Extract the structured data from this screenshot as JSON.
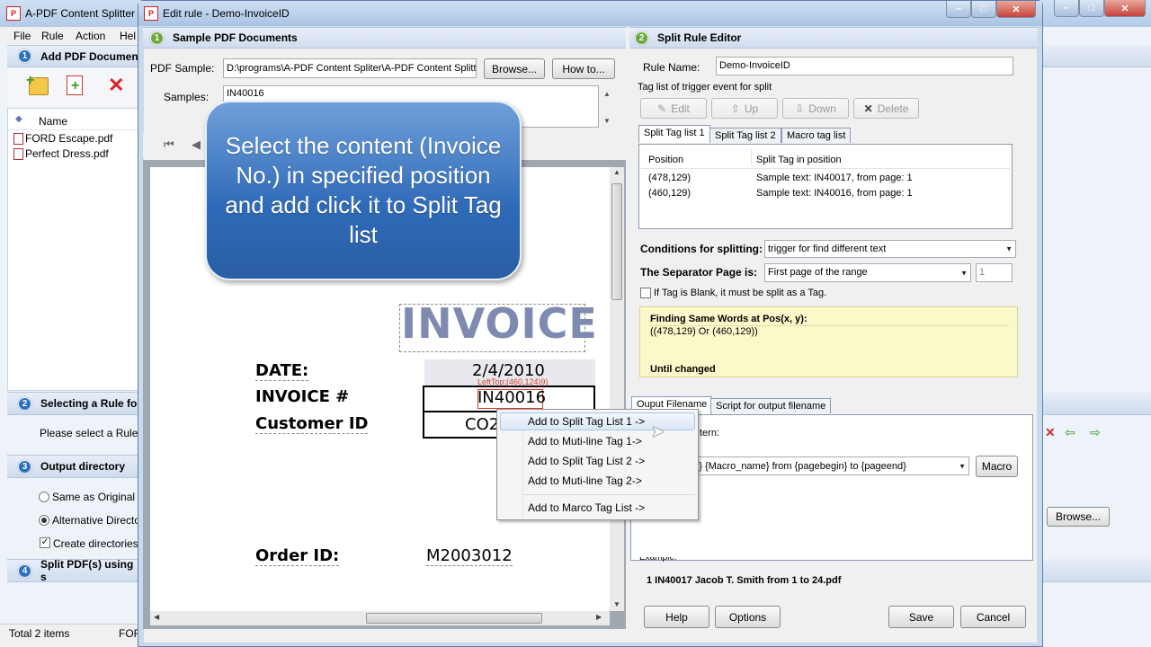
{
  "main_window": {
    "title": "A-PDF Content Splitter",
    "menu": [
      "File",
      "Rule",
      "Action",
      "Hel"
    ],
    "section1": {
      "num": "1",
      "title": "Add PDF Document"
    },
    "files_header": "Name",
    "files": [
      "FORD Escape.pdf",
      "Perfect Dress.pdf"
    ],
    "section2": {
      "num": "2",
      "title": "Selecting a Rule for"
    },
    "select_rule_label": "Please select a Rule:",
    "section3": {
      "num": "3",
      "title": "Output directory"
    },
    "radio_same": "Same as Original di",
    "radio_alt": "Alternative Director",
    "checkbox_create": "Create directories f",
    "browse": "Browse...",
    "section4": {
      "num": "4",
      "title": "Split PDF(s) using s"
    },
    "status_total": "Total 2 items",
    "status_fo": "FOR"
  },
  "dialog": {
    "title": "Edit rule - Demo-InvoiceID",
    "left_panel": {
      "num": "1",
      "title": "Sample PDF Documents",
      "pdf_sample_label": "PDF Sample:",
      "pdf_sample_value": "D:\\programs\\A-PDF Content Spliter\\A-PDF Content Splitte",
      "browse_label": "Browse...",
      "howto_label": "How to...",
      "samples_label": "Samples:",
      "samples_value": "IN40016"
    },
    "callout": "Select the content (Invoice No.) in specified position and add click it to Split Tag list",
    "document": {
      "invoice_title": "INVOICE",
      "date_label": "DATE:",
      "date_value": "2/4/2010",
      "invoice_no_label": "INVOICE #",
      "invoice_no_value": "IN40016",
      "lefttop_tip": "LeftTop:(460,124)9)",
      "customer_label": "Customer ID",
      "customer_value": "CO2",
      "order_label": "Order ID:",
      "order_value": "M2003012"
    },
    "context_menu": [
      "Add to Split Tag List 1 ->",
      "Add to Muti-line Tag  1->",
      "Add to Split Tag List 2 ->",
      "Add to Muti-line Tag  2->",
      "Add to Marco Tag List ->"
    ],
    "right_panel": {
      "num": "2",
      "title": "Split Rule Editor",
      "rule_name_label": "Rule Name:",
      "rule_name_value": "Demo-InvoiceID",
      "tag_list_label": "Tag list of trigger event for split",
      "toolbar": {
        "edit": "Edit",
        "up": "Up",
        "down": "Down",
        "delete": "Delete"
      },
      "tabs": [
        "Split Tag list 1",
        "Split Tag list 2",
        "Macro tag list"
      ],
      "table_headers": [
        "Position",
        "Split Tag in position"
      ],
      "table_rows": [
        [
          "(478,129)",
          "Sample text: IN40017, from page: 1"
        ],
        [
          "(460,129)",
          "Sample text: IN40016, from page: 1"
        ]
      ],
      "conditions_label": "Conditions for splitting:",
      "conditions_value": "trigger for find different text",
      "separator_label": "The Separator Page is:",
      "separator_value": "First page of the range",
      "separator_num": "1",
      "blank_checkbox": "If Tag is Blank, it must be split as a Tag.",
      "info_title": "Finding Same Words at Pos(x, y):",
      "info_value": "((478,129) Or (460,129))",
      "info_until": "Until changed",
      "out_tabs": [
        "Ouput Filename",
        "Script for output filename"
      ],
      "pattern_label": "tern:",
      "pattern_value": "ag} {Macro_name}  from {pagebegin} to {pageend}",
      "macro_btn": "Macro",
      "example_label": "Example:",
      "example_value": "1 IN40017 Jacob T. Smith  from 1 to 24.pdf",
      "help_btn": "Help",
      "options_btn": "Options",
      "save_btn": "Save",
      "cancel_btn": "Cancel"
    }
  },
  "colors": {
    "titlebar": "#bcd3ee",
    "section_header": "#d5e1f0",
    "callout": "#2f6ab8",
    "info_box": "#fbf9c9",
    "close_button": "#c8423a",
    "doc_highlight": "#e8e8ef",
    "invoice_title_color": "#7f8ab0",
    "tip_color": "#d63c2a"
  }
}
